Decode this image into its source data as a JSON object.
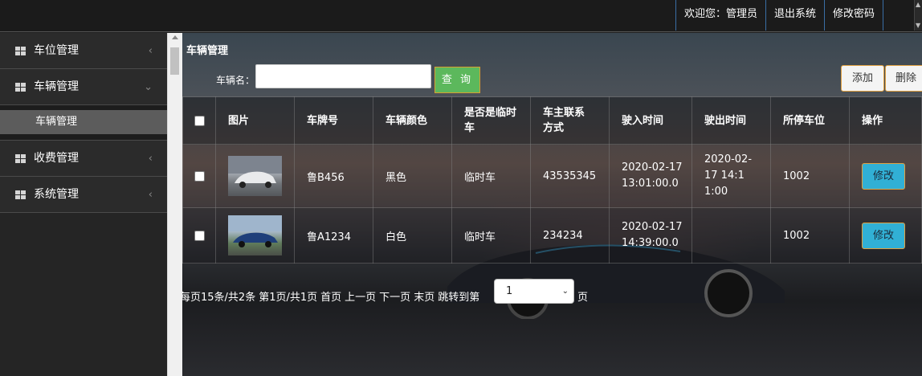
{
  "header": {
    "welcome": "欢迎您：管理员",
    "logout": "退出系统",
    "change_password": "修改密码"
  },
  "sidebar": {
    "items": [
      {
        "label": "车位管理",
        "icon": "grid-icon",
        "chevron": "‹"
      },
      {
        "label": "车辆管理",
        "icon": "grid-icon",
        "chevron": "⌄",
        "expanded": true,
        "children": [
          {
            "label": "车辆管理"
          }
        ]
      },
      {
        "label": "收费管理",
        "icon": "grid-icon",
        "chevron": "‹"
      },
      {
        "label": "系统管理",
        "icon": "grid-icon",
        "chevron": "‹"
      }
    ]
  },
  "main": {
    "title": "车辆管理",
    "search": {
      "label": "车辆名：",
      "value": "",
      "placeholder": "",
      "button": "查 询"
    },
    "actions": {
      "add": "添加",
      "delete": "删除"
    },
    "table": {
      "headers": [
        "图片",
        "车牌号",
        "车辆颜色",
        "是否是临时车",
        "车主联系方式",
        "驶入时间",
        "驶出时间",
        "所停车位",
        "操作"
      ],
      "rows": [
        {
          "plate": "鲁B456",
          "color": "黑色",
          "temp": "临时车",
          "contact": "43535345",
          "in_time": "2020-02-17 13:01:00.0",
          "out_time": "2020-02-17 14:11:00",
          "spot": "1002",
          "action": "修改",
          "image": "white-suv-thumbnail"
        },
        {
          "plate": "鲁A1234",
          "color": "白色",
          "temp": "临时车",
          "contact": "234234",
          "in_time": "2020-02-17 14:39:00.0",
          "out_time": "",
          "spot": "1002",
          "action": "修改",
          "image": "blue-sedan-thumbnail"
        }
      ]
    },
    "pager": {
      "summary": "每页15条/共2条",
      "page_info": "第1页/共1页",
      "first": "首页",
      "prev": "上一页",
      "next": "下一页",
      "last": "末页",
      "jump_label": "跳转到第",
      "jump_value": "1",
      "suffix": "页"
    }
  },
  "colors": {
    "accent": "#5cb85c",
    "edit": "#31b0d5",
    "border_accent": "#e0a040",
    "nav_divider": "#3a6ea5"
  }
}
